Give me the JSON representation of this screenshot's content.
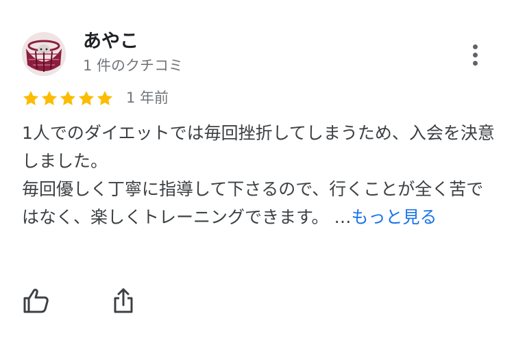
{
  "review": {
    "reviewer": {
      "name": "あやこ",
      "meta": "1 件のクチコミ",
      "avatar_icon": "hamster-in-basket-avatar"
    },
    "rating": {
      "value": 5,
      "max": 5,
      "star_color": "#fbbc04"
    },
    "date": "1 年前",
    "text_lines": [
      "1人でのダイエットでは毎回挫折してしまうため、入会を決意しました。",
      "毎回優しく丁寧に指導して下さるので、行くことが全く苦ではなく、楽しくトレーニングできます。 …"
    ],
    "read_more_label": "もっと見る",
    "link_color": "#1a73e8",
    "actions": {
      "like_icon": "thumbs-up-icon",
      "share_icon": "share-icon",
      "more_icon": "more-vert-icon"
    }
  }
}
